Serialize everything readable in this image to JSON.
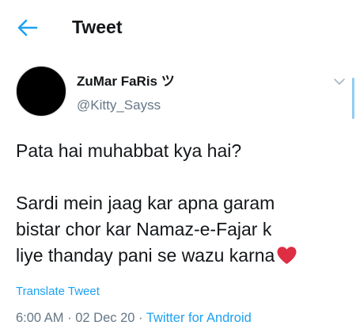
{
  "header": {
    "title": "Tweet",
    "back_icon": "arrow-left-icon"
  },
  "tweet": {
    "author": {
      "display_name": "ZuMar FaRis ツ",
      "handle": "@Kitty_Sayss"
    },
    "menu_icon": "chevron-down-icon",
    "text_lines": [
      "Pata hai muhabbat kya hai?",
      "",
      "Sardi mein jaag kar apna garam",
      "bistar chor kar Namaz-e-Fajar k",
      "liye thanday pani se wazu karna"
    ],
    "emoji": "red-heart-icon",
    "translate_label": "Translate Tweet",
    "time": "6:00 AM",
    "separator": "·",
    "date": "02 Dec 20",
    "source": "Twitter for Android"
  },
  "colors": {
    "accent": "#1da1f2",
    "text": "#14171a",
    "muted": "#657786",
    "heart": "#e0245e"
  }
}
